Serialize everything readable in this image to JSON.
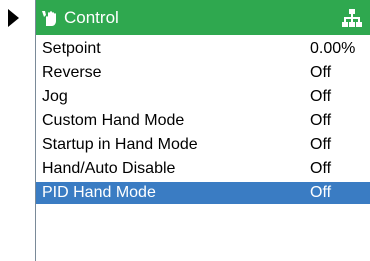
{
  "header": {
    "title": "Control",
    "left_icon": "hand-wrench-icon",
    "right_icon": "network-tree-icon",
    "color": "#2fa84f"
  },
  "selection_color": "#3a7cc3",
  "items": [
    {
      "label": "Setpoint",
      "value": "0.00%",
      "selected": false
    },
    {
      "label": "Reverse",
      "value": "Off",
      "selected": false
    },
    {
      "label": "Jog",
      "value": "Off",
      "selected": false
    },
    {
      "label": "Custom Hand Mode",
      "value": "Off",
      "selected": false
    },
    {
      "label": "Startup in Hand Mode",
      "value": "Off",
      "selected": false
    },
    {
      "label": "Hand/Auto Disable",
      "value": "Off",
      "selected": false
    },
    {
      "label": "PID Hand Mode",
      "value": "Off",
      "selected": true
    }
  ]
}
